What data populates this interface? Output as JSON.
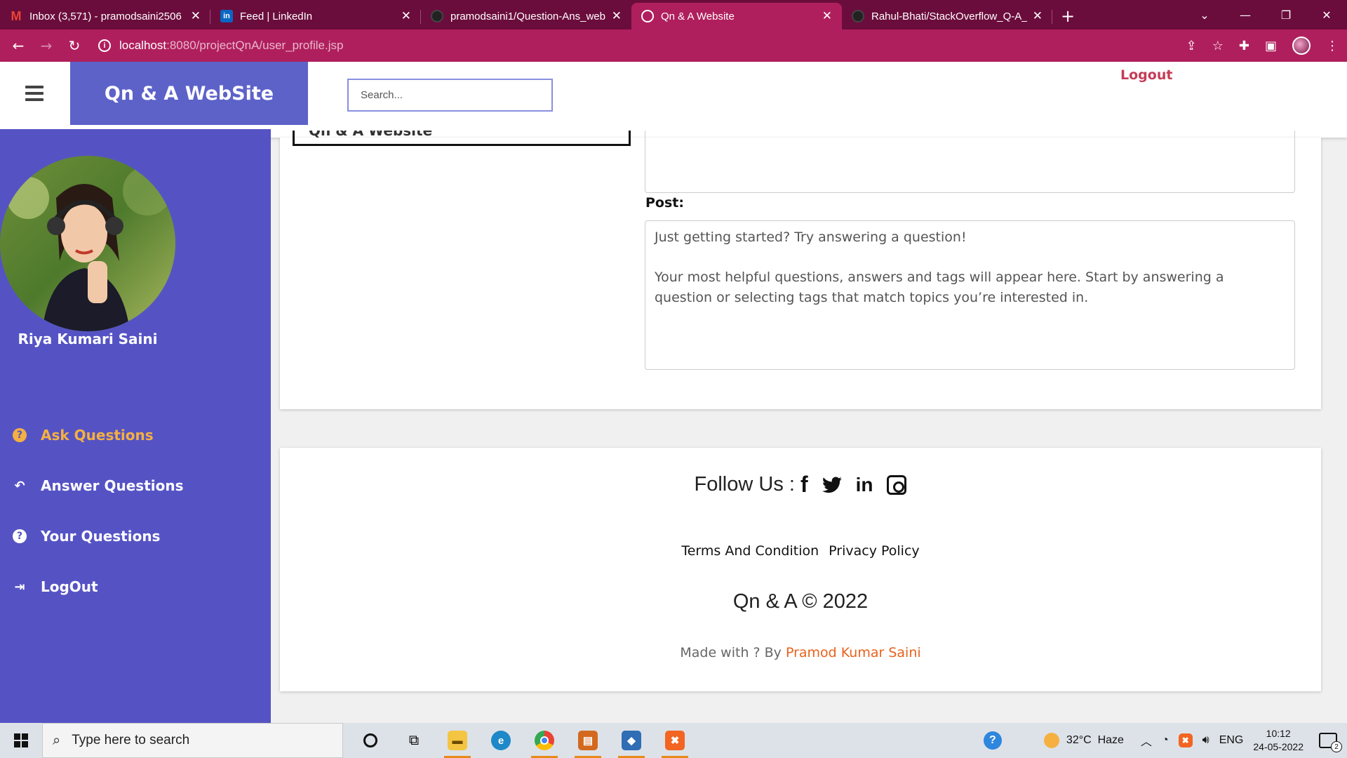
{
  "browser": {
    "tabs": [
      {
        "title": "Inbox (3,571) - pramodsaini2506",
        "favicon": "gmail-icon",
        "active": false
      },
      {
        "title": "Feed | LinkedIn",
        "favicon": "linkedin-icon",
        "active": false
      },
      {
        "title": "pramodsaini1/Question-Ans_web",
        "favicon": "github-icon",
        "active": false
      },
      {
        "title": "Qn & A Website",
        "favicon": "globe-icon",
        "active": true
      },
      {
        "title": "Rahul-Bhati/StackOverflow_Q-A_",
        "favicon": "github-icon",
        "active": false
      }
    ],
    "new_tab": "+",
    "url_host": "localhost",
    "url_path": ":8080/projectQnA/user_profile.jsp",
    "accent": "#b01f5d",
    "tabbar_color": "#6b0d3c"
  },
  "header": {
    "brand": "Qn & A WebSite",
    "search_placeholder": "Search...",
    "logout": "Logout",
    "brand_color": "#5d62c9"
  },
  "sidebar": {
    "user_name": "Riya Kumari Saini",
    "bg_color": "#5553c4",
    "active_color": "#f5b041",
    "items": [
      {
        "label": "Ask Questions",
        "icon": "question-circle-icon",
        "active": true
      },
      {
        "label": "Answer Questions",
        "icon": "reply-icon",
        "active": false
      },
      {
        "label": "Your Questions",
        "icon": "question-circle-icon",
        "active": false
      },
      {
        "label": "LogOut",
        "icon": "sign-out-icon",
        "active": false
      }
    ]
  },
  "main": {
    "prev_box_text": "Qn & A Website",
    "post_label": "Post:",
    "post_text_1": "Just getting started? Try answering a question!",
    "post_text_2": "Your most helpful questions, answers and tags will appear here. Start by answering a question or selecting tags that match topics you’re interested in."
  },
  "footer": {
    "follow_us": "Follow Us :",
    "social": [
      "facebook-icon",
      "twitter-icon",
      "linkedin-icon",
      "instagram-icon"
    ],
    "terms": "Terms And Condition",
    "privacy": "Privacy Policy",
    "copyright": "Qn & A © 2022",
    "made_with": "Made with ? By",
    "author": "Pramod Kumar Saini",
    "author_color": "#e8621d"
  },
  "taskbar": {
    "search_placeholder": "Type here to search",
    "temperature": "32°C",
    "weather": "Haze",
    "language": "ENG",
    "time": "10:12",
    "date": "24-05-2022",
    "notifications": "2"
  }
}
